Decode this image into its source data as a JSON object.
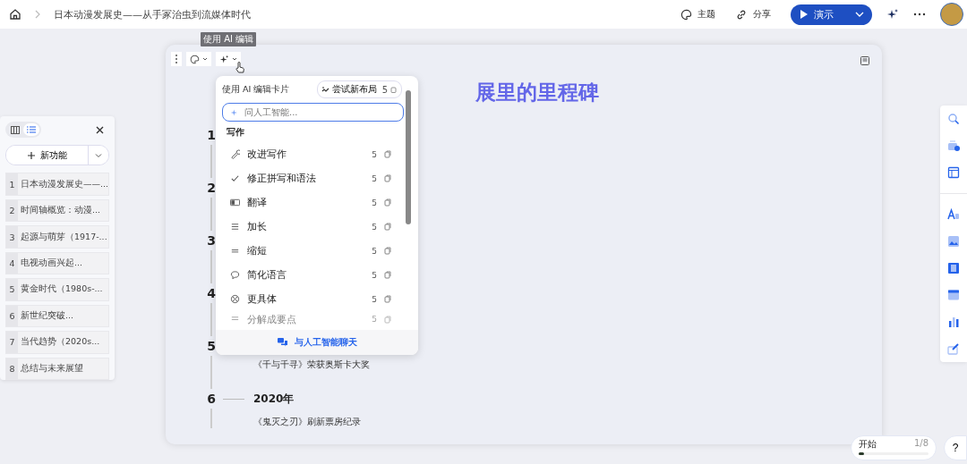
{
  "breadcrumb": {
    "title": "日本动漫发展史——从手冢治虫到流媒体时代"
  },
  "toolbar": {
    "theme": "主题",
    "share": "分享",
    "present": "演示"
  },
  "tooltip": "使用 AI 编辑",
  "slide": {
    "title": "展里的里程碑",
    "timeline": [
      {
        "number": "1"
      },
      {
        "number": "2"
      },
      {
        "number": "3"
      },
      {
        "number": "4"
      },
      {
        "number": "5",
        "description": "《千与千寻》荣获奥斯卡大奖"
      },
      {
        "number": "6",
        "year": "2020年",
        "description": "《鬼灭之刃》刷新票房纪录"
      }
    ]
  },
  "slides_panel": {
    "view_tabs": [
      {
        "kind": "grid",
        "selected": false
      },
      {
        "kind": "list",
        "selected": true
      }
    ],
    "new_button": "新功能",
    "slides": [
      {
        "number": "1",
        "title": "日本动漫发展史——..."
      },
      {
        "number": "2",
        "title": "时间轴概览：动漫..."
      },
      {
        "number": "3",
        "title": "起源与萌芽（1917-..."
      },
      {
        "number": "4",
        "title": "电视动画兴起..."
      },
      {
        "number": "5",
        "title": "黄金时代（1980s-..."
      },
      {
        "number": "6",
        "title": "新世纪突破..."
      },
      {
        "number": "7",
        "title": "当代趋势（2020s..."
      },
      {
        "number": "8",
        "title": "总结与未来展望"
      }
    ]
  },
  "ai_menu": {
    "title": "使用 AI 编辑卡片",
    "try_layout": {
      "label": "尝试新布局",
      "cost": "5"
    },
    "search": {
      "placeholder": "问人工智能..."
    },
    "section": "写作",
    "items": [
      {
        "kind": "improve",
        "label": "改进写作",
        "cost": "5"
      },
      {
        "kind": "fix",
        "label": "修正拼写和语法",
        "cost": "5"
      },
      {
        "kind": "translate",
        "label": "翻译",
        "cost": "5"
      },
      {
        "kind": "longer",
        "label": "加长",
        "cost": "5"
      },
      {
        "kind": "shorter",
        "label": "缩短",
        "cost": "5"
      },
      {
        "kind": "simplify",
        "label": "简化语言",
        "cost": "5"
      },
      {
        "kind": "specific",
        "label": "更具体",
        "cost": "5"
      },
      {
        "kind": "bullets",
        "label": "分解成要点",
        "cost": "5"
      }
    ],
    "chat": "与人工智能聊天"
  },
  "progress": {
    "label": "开始",
    "count": "1/8",
    "level": 0.08
  },
  "help": "?"
}
